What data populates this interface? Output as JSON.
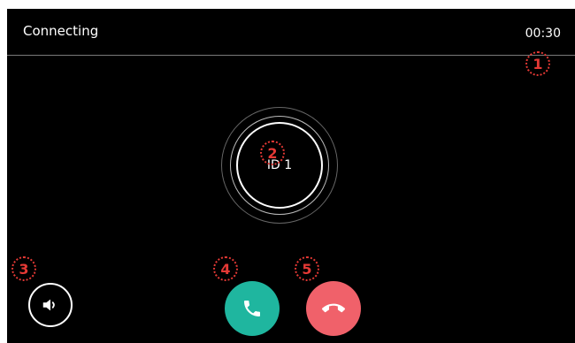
{
  "header": {
    "status": "Connecting",
    "timer": "00:30"
  },
  "call": {
    "device_id": "ID 1"
  },
  "controls": {
    "speaker_icon": "speaker-icon",
    "answer_icon": "phone-icon",
    "hangup_icon": "phone-hangup-icon",
    "answer_color": "#1fb69f",
    "hangup_color": "#f0616a"
  },
  "callouts": [
    "1",
    "2",
    "3",
    "4",
    "5"
  ],
  "colors": {
    "background": "#000000",
    "callout": "#e53935"
  }
}
